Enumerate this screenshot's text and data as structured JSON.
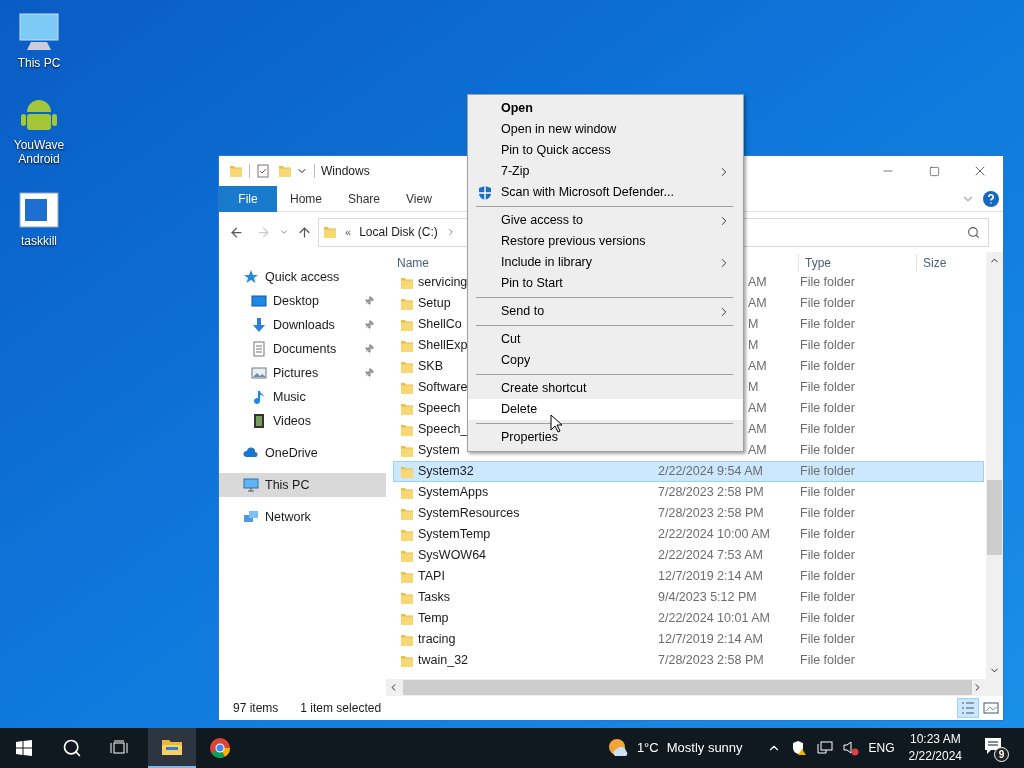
{
  "desktop_icons": [
    {
      "label": "This PC",
      "kind": "pc"
    },
    {
      "label": "YouWave Android",
      "kind": "android"
    },
    {
      "label": "taskkill",
      "kind": "app"
    }
  ],
  "window": {
    "title": "Windows",
    "ribbon_tabs": [
      {
        "label": "File",
        "selected": true
      },
      {
        "label": "Home",
        "selected": false
      },
      {
        "label": "Share",
        "selected": false
      },
      {
        "label": "View",
        "selected": false
      }
    ],
    "address": {
      "overflow": "«",
      "segment": "Local Disk (C:)"
    },
    "nav": [
      {
        "label": "Quick access",
        "kind": "star",
        "selected": false,
        "children": [
          {
            "label": "Desktop",
            "kind": "desktop",
            "pinned": true,
            "selected": false
          },
          {
            "label": "Downloads",
            "kind": "downloads",
            "pinned": true,
            "selected": false
          },
          {
            "label": "Documents",
            "kind": "documents",
            "pinned": true,
            "selected": false
          },
          {
            "label": "Pictures",
            "kind": "pictures",
            "pinned": true,
            "selected": false
          },
          {
            "label": "Music",
            "kind": "music",
            "pinned": false,
            "selected": false
          },
          {
            "label": "Videos",
            "kind": "videos",
            "pinned": false,
            "selected": false
          }
        ]
      },
      {
        "label": "OneDrive",
        "kind": "cloud",
        "selected": false
      },
      {
        "label": "This PC",
        "kind": "pc",
        "selected": true
      },
      {
        "label": "Network",
        "kind": "network",
        "selected": false
      }
    ],
    "columns": [
      "Name",
      "Type",
      "Size"
    ],
    "rows": [
      {
        "name": "servicing",
        "date": "AM",
        "type": "File folder",
        "covered": true,
        "selected": false
      },
      {
        "name": "Setup",
        "date": "AM",
        "type": "File folder",
        "covered": true,
        "selected": false
      },
      {
        "name": "ShellCo",
        "date": "M",
        "type": "File folder",
        "covered": true,
        "selected": false
      },
      {
        "name": "ShellExp",
        "date": "M",
        "type": "File folder",
        "covered": true,
        "selected": false
      },
      {
        "name": "SKB",
        "date": "AM",
        "type": "File folder",
        "covered": true,
        "selected": false
      },
      {
        "name": "Software",
        "date": "M",
        "type": "File folder",
        "covered": true,
        "selected": false
      },
      {
        "name": "Speech",
        "date": "AM",
        "type": "File folder",
        "covered": true,
        "selected": false
      },
      {
        "name": "Speech_",
        "date": "AM",
        "type": "File folder",
        "covered": true,
        "selected": false
      },
      {
        "name": "System",
        "date": "AM",
        "type": "File folder",
        "covered": true,
        "selected": false
      },
      {
        "name": "System32",
        "date": "2/22/2024 9:54 AM",
        "type": "File folder",
        "covered": false,
        "selected": true
      },
      {
        "name": "SystemApps",
        "date": "7/28/2023 2:58 PM",
        "type": "File folder",
        "covered": false,
        "selected": false
      },
      {
        "name": "SystemResources",
        "date": "7/28/2023 2:58 PM",
        "type": "File folder",
        "covered": false,
        "selected": false
      },
      {
        "name": "SystemTemp",
        "date": "2/22/2024 10:00 AM",
        "type": "File folder",
        "covered": false,
        "selected": false
      },
      {
        "name": "SysWOW64",
        "date": "2/22/2024 7:53 AM",
        "type": "File folder",
        "covered": false,
        "selected": false
      },
      {
        "name": "TAPI",
        "date": "12/7/2019 2:14 AM",
        "type": "File folder",
        "covered": false,
        "selected": false
      },
      {
        "name": "Tasks",
        "date": "9/4/2023 5:12 PM",
        "type": "File folder",
        "covered": false,
        "selected": false
      },
      {
        "name": "Temp",
        "date": "2/22/2024 10:01 AM",
        "type": "File folder",
        "covered": false,
        "selected": false
      },
      {
        "name": "tracing",
        "date": "12/7/2019 2:14 AM",
        "type": "File folder",
        "covered": false,
        "selected": false
      },
      {
        "name": "twain_32",
        "date": "7/28/2023 2:58 PM",
        "type": "File folder",
        "covered": false,
        "selected": false
      }
    ],
    "status_bar": {
      "count": "97 items",
      "selection": "1 item selected"
    }
  },
  "context_menu": [
    {
      "kind": "item",
      "label": "Open",
      "bold": true,
      "submenu": false,
      "shield": false,
      "hovered": false
    },
    {
      "kind": "item",
      "label": "Open in new window",
      "bold": false,
      "submenu": false,
      "shield": false,
      "hovered": false
    },
    {
      "kind": "item",
      "label": "Pin to Quick access",
      "bold": false,
      "submenu": false,
      "shield": false,
      "hovered": false
    },
    {
      "kind": "item",
      "label": "7-Zip",
      "bold": false,
      "submenu": true,
      "shield": false,
      "hovered": false
    },
    {
      "kind": "item",
      "label": "Scan with Microsoft Defender...",
      "bold": false,
      "submenu": false,
      "shield": true,
      "hovered": false
    },
    {
      "kind": "separator"
    },
    {
      "kind": "item",
      "label": "Give access to",
      "bold": false,
      "submenu": true,
      "shield": false,
      "hovered": false
    },
    {
      "kind": "item",
      "label": "Restore previous versions",
      "bold": false,
      "submenu": false,
      "shield": false,
      "hovered": false
    },
    {
      "kind": "item",
      "label": "Include in library",
      "bold": false,
      "submenu": true,
      "shield": false,
      "hovered": false
    },
    {
      "kind": "item",
      "label": "Pin to Start",
      "bold": false,
      "submenu": false,
      "shield": false,
      "hovered": false
    },
    {
      "kind": "separator"
    },
    {
      "kind": "item",
      "label": "Send to",
      "bold": false,
      "submenu": true,
      "shield": false,
      "hovered": false
    },
    {
      "kind": "separator"
    },
    {
      "kind": "item",
      "label": "Cut",
      "bold": false,
      "submenu": false,
      "shield": false,
      "hovered": false
    },
    {
      "kind": "item",
      "label": "Copy",
      "bold": false,
      "submenu": false,
      "shield": false,
      "hovered": false
    },
    {
      "kind": "separator"
    },
    {
      "kind": "item",
      "label": "Create shortcut",
      "bold": false,
      "submenu": false,
      "shield": false,
      "hovered": false
    },
    {
      "kind": "item",
      "label": "Delete",
      "bold": false,
      "submenu": false,
      "shield": false,
      "hovered": true
    },
    {
      "kind": "separator"
    },
    {
      "kind": "item",
      "label": "Properties",
      "bold": false,
      "submenu": false,
      "shield": false,
      "hovered": false
    }
  ],
  "taskbar": {
    "apps": [
      {
        "kind": "explorer",
        "active": true
      },
      {
        "kind": "chrome",
        "active": false
      }
    ],
    "weather": {
      "temperature": "1°C",
      "condition": "Mostly sunny"
    },
    "language": "ENG",
    "time": "10:23 AM",
    "date": "2/22/2024",
    "notifications": "9"
  }
}
